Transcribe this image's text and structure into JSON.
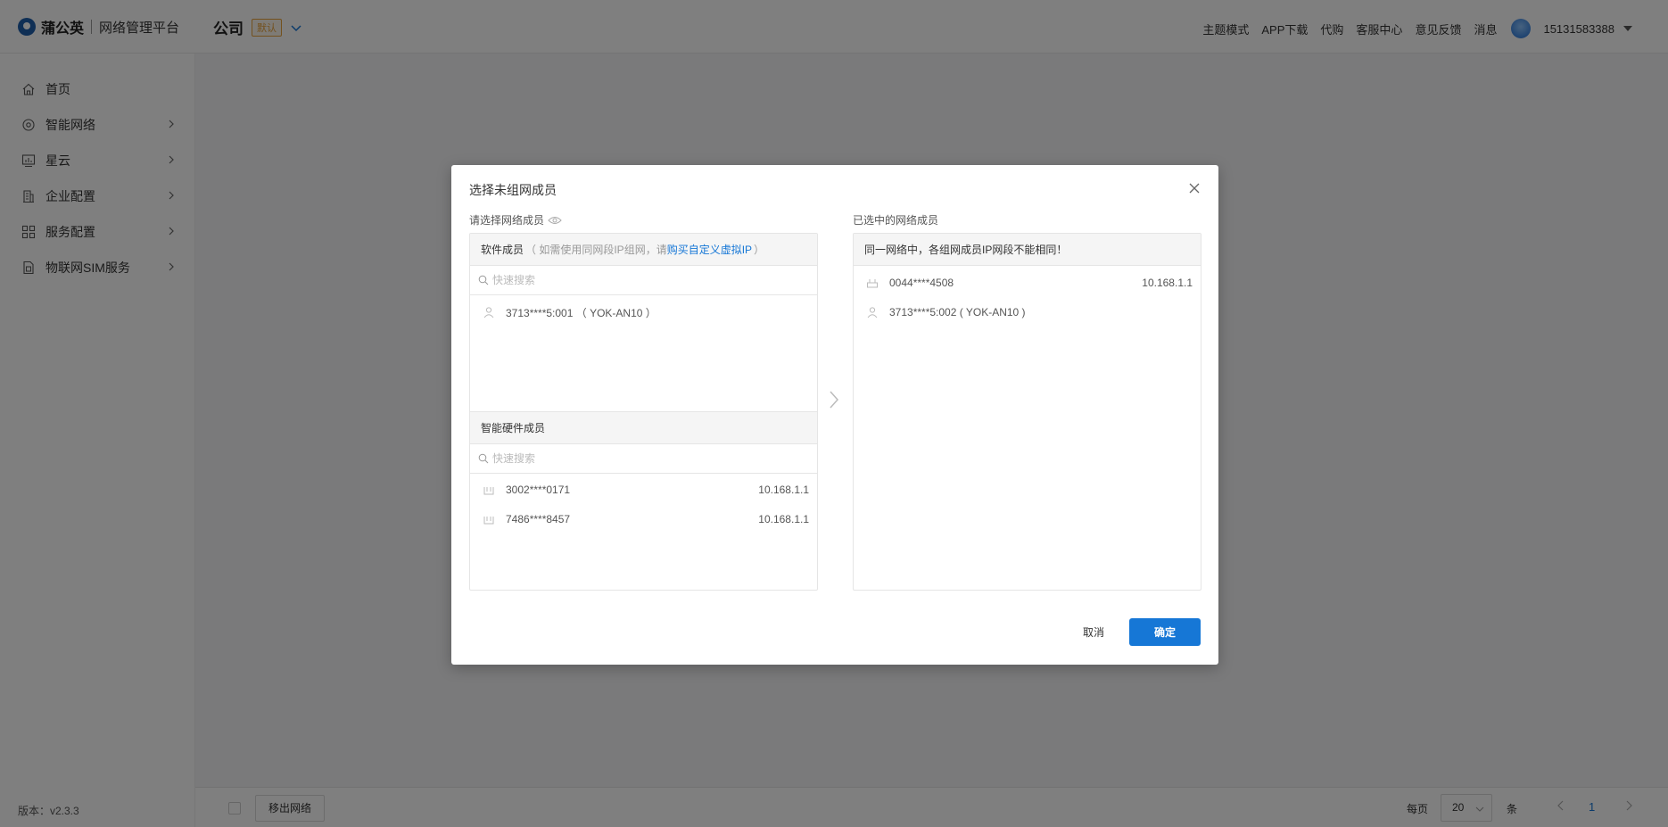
{
  "header": {
    "brand": "蒲公英",
    "platform": "网络管理平台",
    "company": "公司",
    "default_badge": "默认",
    "nav": [
      "主题模式",
      "APP下载",
      "代购",
      "客服中心",
      "意见反馈",
      "消息"
    ],
    "user_phone": "15131583388"
  },
  "sidebar": {
    "items": [
      {
        "label": "首页",
        "icon": "home-icon",
        "has_arrow": false
      },
      {
        "label": "智能网络",
        "icon": "network-icon",
        "has_arrow": true
      },
      {
        "label": "星云",
        "icon": "chart-icon",
        "has_arrow": true
      },
      {
        "label": "企业配置",
        "icon": "building-icon",
        "has_arrow": true
      },
      {
        "label": "服务配置",
        "icon": "grid-icon",
        "has_arrow": true
      },
      {
        "label": "物联网SIM服务",
        "icon": "sim-icon",
        "has_arrow": true
      }
    ],
    "version": "版本：v2.3.3"
  },
  "bottom_bar": {
    "remove_label": "移出网络",
    "per_page_label": "每页",
    "page_size": "20",
    "unit_label": "条",
    "current_page": "1"
  },
  "modal": {
    "title": "选择未组网成员",
    "left_label": "请选择网络成员",
    "right_label": "已选中的网络成员",
    "software": {
      "header": "软件成员",
      "hint_prefix": "（ 如需使用同网段IP组网，请",
      "hint_link": "购买自定义虚拟IP",
      "hint_suffix": "）",
      "search_placeholder": "快速搜索",
      "items": [
        {
          "name": "3713****5:001 （ YOK-AN10 ）"
        }
      ]
    },
    "hardware": {
      "header": "智能硬件成员",
      "search_placeholder": "快速搜索",
      "items": [
        {
          "name": "3002****0171",
          "ip": "10.168.1.1"
        },
        {
          "name": "7486****8457",
          "ip": "10.168.1.1"
        }
      ]
    },
    "selected": {
      "header": "同一网络中，各组网成员IP网段不能相同！",
      "items": [
        {
          "name": "0044****4508",
          "ip": "10.168.1.1",
          "icon": "router-icon"
        },
        {
          "name": "3713****5:002 ( YOK-AN10 )",
          "ip": "",
          "icon": "user-icon"
        }
      ]
    },
    "cancel_label": "取消",
    "ok_label": "确定"
  },
  "colors": {
    "primary": "#1677d6",
    "badge": "#e6a23c",
    "overlay": "rgba(0,0,0,0.5)"
  }
}
